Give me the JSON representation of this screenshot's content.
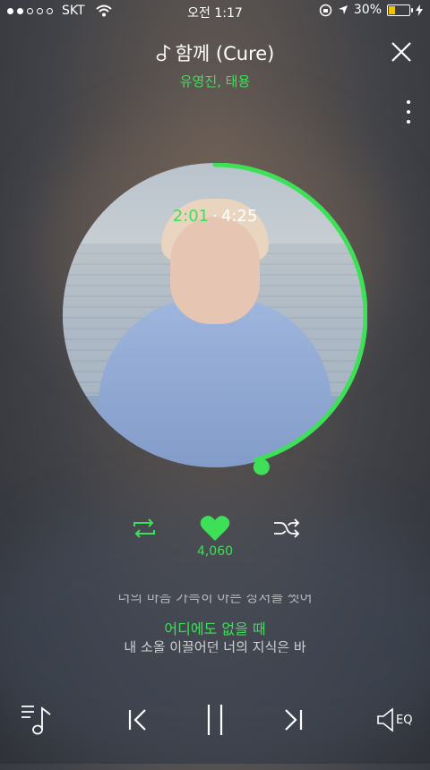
{
  "status_bar": {
    "carrier": "SKT",
    "time": "오전 1:17",
    "battery": "30%",
    "signal_bars": 2,
    "battery_level": 0.3
  },
  "player": {
    "song_title": "함께 (Cure)",
    "artist": "유영진, 태용",
    "elapsed": "2:01",
    "duration": "4:25",
    "progress_fraction": 0.456,
    "likes": "4,060"
  },
  "lyrics": {
    "previous": "너의 마음 가득히 아픈 상처를 씻어",
    "current": "어디에도 없을 때",
    "next": "내 소올 이끌어던 너의 지식은 바"
  },
  "bottom_bar": {
    "eq_label": "EQ"
  },
  "colors": {
    "accent": "#3ee057",
    "text": "#ffffff"
  }
}
